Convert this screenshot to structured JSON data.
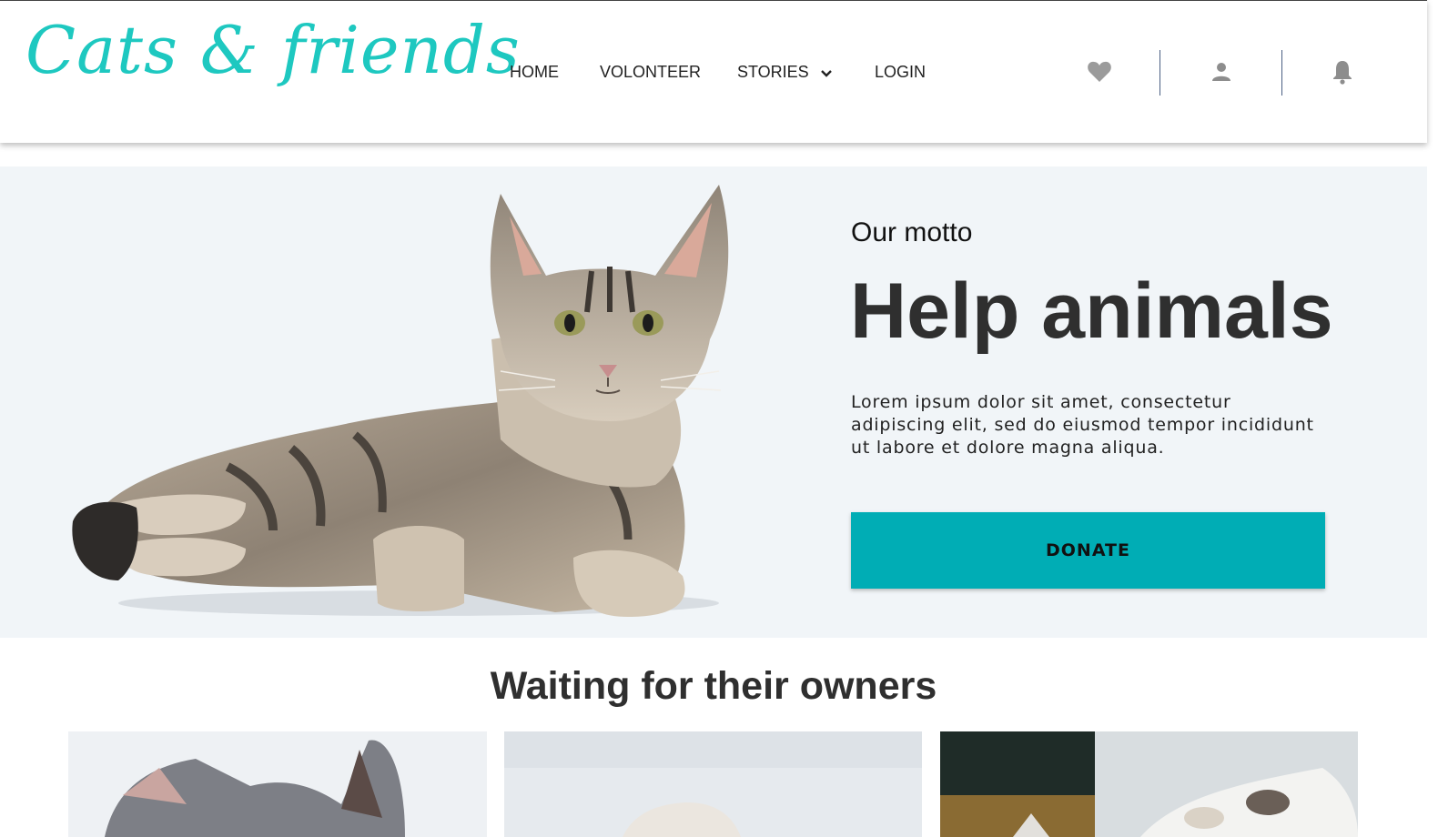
{
  "brand": {
    "logo_text": "Cats & friends",
    "accent_color": "#1ec8c0"
  },
  "nav": {
    "items": [
      {
        "label": "HOME"
      },
      {
        "label": "VOLONTEER"
      },
      {
        "label": "STORIES",
        "has_dropdown": true
      },
      {
        "label": "LOGIN"
      }
    ]
  },
  "header_icons": [
    "heart-icon",
    "user-icon",
    "bell-icon"
  ],
  "hero": {
    "motto_label": "Our motto",
    "headline": "Help animals",
    "body": "Lorem ipsum dolor sit amet, consectetur adipiscing elit, sed do eiusmod tempor incididunt ut labore et dolore magna aliqua.",
    "donate_label": "DONATE",
    "donate_color": "#00adb5",
    "background_color": "#f1f5f8"
  },
  "section": {
    "title": "Waiting for their owners"
  },
  "cards": [
    {
      "icon": "kitten-photo"
    },
    {
      "icon": "kitten-photo"
    },
    {
      "icon": "kitten-photo"
    }
  ]
}
